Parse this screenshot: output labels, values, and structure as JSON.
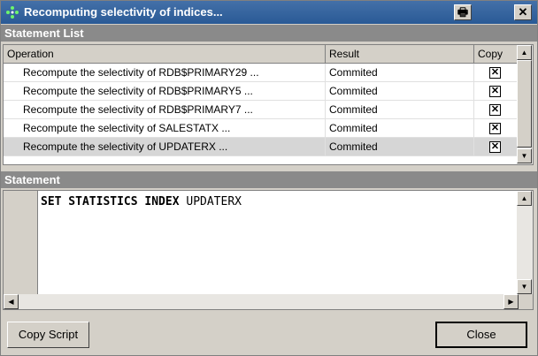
{
  "window": {
    "title": "Recomputing selectivity of indices...",
    "print_button": "🖶",
    "close_button": "✕"
  },
  "statement_list": {
    "header": "Statement List",
    "columns": {
      "operation": "Operation",
      "result": "Result",
      "copy": "Copy"
    },
    "rows": [
      {
        "operation": "Recompute the selectivity of RDB$PRIMARY29 ...",
        "result": "Commited",
        "copy": true
      },
      {
        "operation": "Recompute the selectivity of RDB$PRIMARY5 ...",
        "result": "Commited",
        "copy": true
      },
      {
        "operation": "Recompute the selectivity of RDB$PRIMARY7 ...",
        "result": "Commited",
        "copy": true
      },
      {
        "operation": "Recompute the selectivity of SALESTATX ...",
        "result": "Commited",
        "copy": true
      },
      {
        "operation": "Recompute the selectivity of UPDATERX ...",
        "result": "Commited",
        "copy": true
      }
    ],
    "check_mark": "✕"
  },
  "statement": {
    "header": "Statement",
    "keyword": "SET STATISTICS INDEX",
    "argument": " UPDATERX"
  },
  "buttons": {
    "copy_script": "Copy Script",
    "close": "Close"
  },
  "scroll_glyphs": {
    "up": "▲",
    "down": "▼",
    "left": "◀",
    "right": "▶"
  }
}
